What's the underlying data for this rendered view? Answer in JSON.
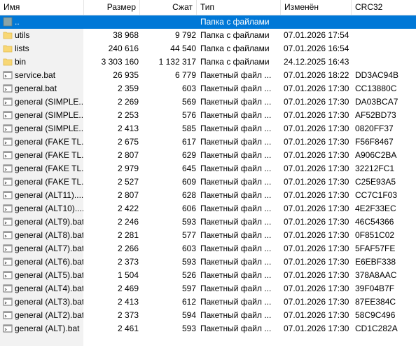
{
  "columns": {
    "name": "Имя",
    "size": "Размер",
    "packed": "Сжат",
    "type": "Тип",
    "modified": "Изменён",
    "crc": "CRC32"
  },
  "rows": [
    {
      "icon": "parent-folder-icon",
      "name": "..",
      "size": "",
      "packed": "",
      "type": "Папка с файлами",
      "modified": "",
      "crc": "",
      "selected": true
    },
    {
      "icon": "folder-icon",
      "name": "utils",
      "size": "38 968",
      "packed": "9 792",
      "type": "Папка с файлами",
      "modified": "07.01.2026 17:54",
      "crc": ""
    },
    {
      "icon": "folder-icon",
      "name": "lists",
      "size": "240 616",
      "packed": "44 540",
      "type": "Папка с файлами",
      "modified": "07.01.2026 16:54",
      "crc": ""
    },
    {
      "icon": "folder-icon",
      "name": "bin",
      "size": "3 303 160",
      "packed": "1 132 317",
      "type": "Папка с файлами",
      "modified": "24.12.2025 16:43",
      "crc": ""
    },
    {
      "icon": "batch-file-icon",
      "name": "service.bat",
      "size": "26 935",
      "packed": "6 779",
      "type": "Пакетный файл ...",
      "modified": "07.01.2026 18:22",
      "crc": "DD3AC94B"
    },
    {
      "icon": "batch-file-icon",
      "name": "general.bat",
      "size": "2 359",
      "packed": "603",
      "type": "Пакетный файл ...",
      "modified": "07.01.2026 17:30",
      "crc": "CC13880C"
    },
    {
      "icon": "batch-file-icon",
      "name": "general (SIMPLE...",
      "size": "2 269",
      "packed": "569",
      "type": "Пакетный файл ...",
      "modified": "07.01.2026 17:30",
      "crc": "DA03BCA7"
    },
    {
      "icon": "batch-file-icon",
      "name": "general (SIMPLE...",
      "size": "2 253",
      "packed": "576",
      "type": "Пакетный файл ...",
      "modified": "07.01.2026 17:30",
      "crc": "AF52BD73"
    },
    {
      "icon": "batch-file-icon",
      "name": "general (SIMPLE...",
      "size": "2 413",
      "packed": "585",
      "type": "Пакетный файл ...",
      "modified": "07.01.2026 17:30",
      "crc": "0820FF37"
    },
    {
      "icon": "batch-file-icon",
      "name": "general (FAKE TL...",
      "size": "2 675",
      "packed": "617",
      "type": "Пакетный файл ...",
      "modified": "07.01.2026 17:30",
      "crc": "F56F8467"
    },
    {
      "icon": "batch-file-icon",
      "name": "general (FAKE TL...",
      "size": "2 807",
      "packed": "629",
      "type": "Пакетный файл ...",
      "modified": "07.01.2026 17:30",
      "crc": "A906C2BA"
    },
    {
      "icon": "batch-file-icon",
      "name": "general (FAKE TL...",
      "size": "2 979",
      "packed": "645",
      "type": "Пакетный файл ...",
      "modified": "07.01.2026 17:30",
      "crc": "32212FC1"
    },
    {
      "icon": "batch-file-icon",
      "name": "general (FAKE TL...",
      "size": "2 527",
      "packed": "609",
      "type": "Пакетный файл ...",
      "modified": "07.01.2026 17:30",
      "crc": "C25E93A5"
    },
    {
      "icon": "batch-file-icon",
      "name": "general (ALT11)....",
      "size": "2 807",
      "packed": "628",
      "type": "Пакетный файл ...",
      "modified": "07.01.2026 17:30",
      "crc": "CC7C1F03"
    },
    {
      "icon": "batch-file-icon",
      "name": "general (ALT10)....",
      "size": "2 422",
      "packed": "606",
      "type": "Пакетный файл ...",
      "modified": "07.01.2026 17:30",
      "crc": "4E2F33EC"
    },
    {
      "icon": "batch-file-icon",
      "name": "general (ALT9).bat",
      "size": "2 246",
      "packed": "593",
      "type": "Пакетный файл ...",
      "modified": "07.01.2026 17:30",
      "crc": "46C54366"
    },
    {
      "icon": "batch-file-icon",
      "name": "general (ALT8).bat",
      "size": "2 281",
      "packed": "577",
      "type": "Пакетный файл ...",
      "modified": "07.01.2026 17:30",
      "crc": "0F851C02"
    },
    {
      "icon": "batch-file-icon",
      "name": "general (ALT7).bat",
      "size": "2 266",
      "packed": "603",
      "type": "Пакетный файл ...",
      "modified": "07.01.2026 17:30",
      "crc": "5FAF57FE"
    },
    {
      "icon": "batch-file-icon",
      "name": "general (ALT6).bat",
      "size": "2 373",
      "packed": "593",
      "type": "Пакетный файл ...",
      "modified": "07.01.2026 17:30",
      "crc": "E6EBF338"
    },
    {
      "icon": "batch-file-icon",
      "name": "general (ALT5).bat",
      "size": "1 504",
      "packed": "526",
      "type": "Пакетный файл ...",
      "modified": "07.01.2026 17:30",
      "crc": "378A8AAC"
    },
    {
      "icon": "batch-file-icon",
      "name": "general (ALT4).bat",
      "size": "2 469",
      "packed": "597",
      "type": "Пакетный файл ...",
      "modified": "07.01.2026 17:30",
      "crc": "39F04B7F"
    },
    {
      "icon": "batch-file-icon",
      "name": "general (ALT3).bat",
      "size": "2 413",
      "packed": "612",
      "type": "Пакетный файл ...",
      "modified": "07.01.2026 17:30",
      "crc": "87EE384C"
    },
    {
      "icon": "batch-file-icon",
      "name": "general (ALT2).bat",
      "size": "2 373",
      "packed": "594",
      "type": "Пакетный файл ...",
      "modified": "07.01.2026 17:30",
      "crc": "58C9C496"
    },
    {
      "icon": "batch-file-icon",
      "name": "general (ALT).bat",
      "size": "2 461",
      "packed": "593",
      "type": "Пакетный файл ...",
      "modified": "07.01.2026 17:30",
      "crc": "CD1C282A"
    }
  ],
  "colors": {
    "selection": "#0078d7",
    "name_column_bg": "#f2f2f2",
    "folder": "#f8d775",
    "folder_dark": "#e0b94a"
  }
}
